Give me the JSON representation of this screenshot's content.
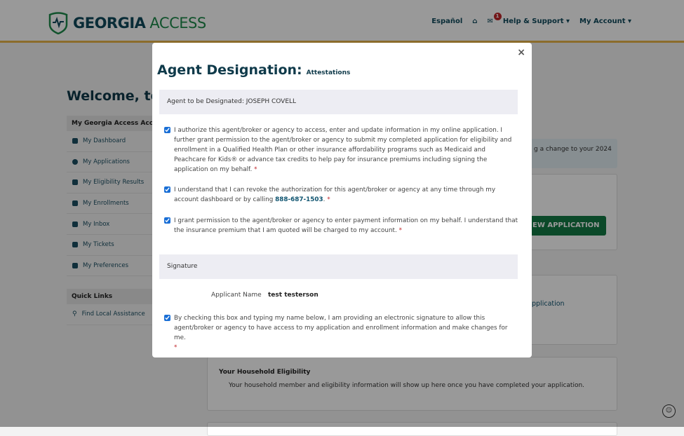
{
  "header": {
    "logo_bold": "GEORGIA",
    "logo_light": "ACCESS",
    "nav": {
      "language": "Español",
      "home_icon": "home-icon",
      "messages_icon": "envelope-icon",
      "messages_badge": "1",
      "help": "Help & Support",
      "account": "My Account"
    }
  },
  "welcome": "Welcome, test",
  "sidebar": {
    "header": "My Georgia Access Account",
    "items": [
      {
        "label": "My Dashboard",
        "icon": "dashboard-icon"
      },
      {
        "label": "My Applications",
        "icon": "info-icon"
      },
      {
        "label": "My Eligibility Results",
        "icon": "clipboard-icon"
      },
      {
        "label": "My Enrollments",
        "icon": "checkbox-icon"
      },
      {
        "label": "My Inbox",
        "icon": "envelope-icon"
      },
      {
        "label": "My Tickets",
        "icon": "ticket-icon"
      },
      {
        "label": "My Preferences",
        "icon": "phone-icon"
      }
    ],
    "quick_links": "Quick Links",
    "quick_items": [
      {
        "label": "Find Local Assistance",
        "icon": "search-icon"
      }
    ]
  },
  "main": {
    "banner_fragment": "g a change to your 2024",
    "button_fragment": "EW APPLICATION",
    "link_fragment": "pplication",
    "household_title": "Your Household Eligibility",
    "household_text": "Your household member and eligibility information will show up here once you have completed your application."
  },
  "modal": {
    "title": "Agent Designation:",
    "subtitle": "Attestations",
    "agent": "Agent to be Designated: JOSEPH COVELL",
    "attest1": "I authorize this agent/broker or agency to access, enter and update information in my online application. I further grant permission to the agent/broker or agency to submit my completed application for eligibility and enrollment in a Qualified Health Plan or other insurance affordability programs such as Medicaid and Peachcare for Kids® or advance tax credits to help pay for insurance premiums including signing the application on my behalf.",
    "attest2": "I understand that I can revoke the authorization for this agent/broker or agency at any time through my account dashboard or by calling ",
    "phone": "888-687-1503",
    "attest3": "I grant permission to the agent/broker or agency to enter payment information on my behalf. I understand that the insurance premium that I am quoted will be charged to my account.",
    "signature": "Signature",
    "applicant_label": "Applicant Name",
    "applicant_name": "test testerson",
    "attest4": "By checking this box and typing my name below, I am providing an electronic signature to allow this agent/broker or agency to have access to my application and enrollment information and make changes for me.",
    "required": "*",
    "close": "×"
  },
  "colors": {
    "brand_dark": "#0f4a5c",
    "brand_green": "#1f8a4c",
    "accent_gold": "#e8b54a",
    "required": "#c0262b"
  }
}
